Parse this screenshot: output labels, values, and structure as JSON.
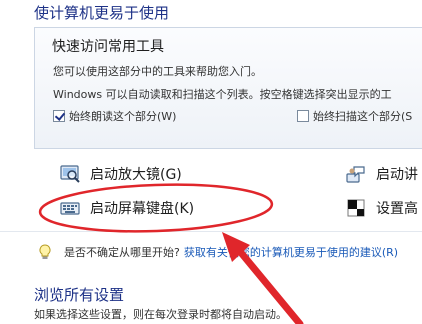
{
  "page": {
    "title": "使计算机更易于使用"
  },
  "quick_access": {
    "title": "快速访问常用工具",
    "description": "您可以使用这部分中的工具来帮助您入门。",
    "scan_text": "Windows 可以自动读取和扫描这个列表。按空格键选择突出显示的工",
    "read_aloud": {
      "label": "始终朗读这个部分(W)",
      "checked": true
    },
    "auto_scan": {
      "label": "始终扫描这个部分(S",
      "checked": false
    }
  },
  "tools": {
    "magnifier": "启动放大镜(G)",
    "onscreen_keyboard": "启动屏幕键盘(K)",
    "narrator": "启动讲",
    "high_contrast": "设置高"
  },
  "tip": {
    "text": "是否不确定从哪里开始?",
    "link": "获取有关使您的计算机更易于使用的建议(R)"
  },
  "browse_all": {
    "title": "浏览所有设置",
    "description": "如果选择这些设置，则在每次登录时都将自动启动。"
  },
  "colors": {
    "heading": "#1e3287",
    "link": "#1a5ab8",
    "annotation": "#e0262b"
  },
  "icons": {
    "magnifier": "magnifier-icon",
    "keyboard": "keyboard-icon",
    "narrator": "narrator-icon",
    "contrast": "contrast-icon",
    "tip": "lightbulb-icon"
  }
}
